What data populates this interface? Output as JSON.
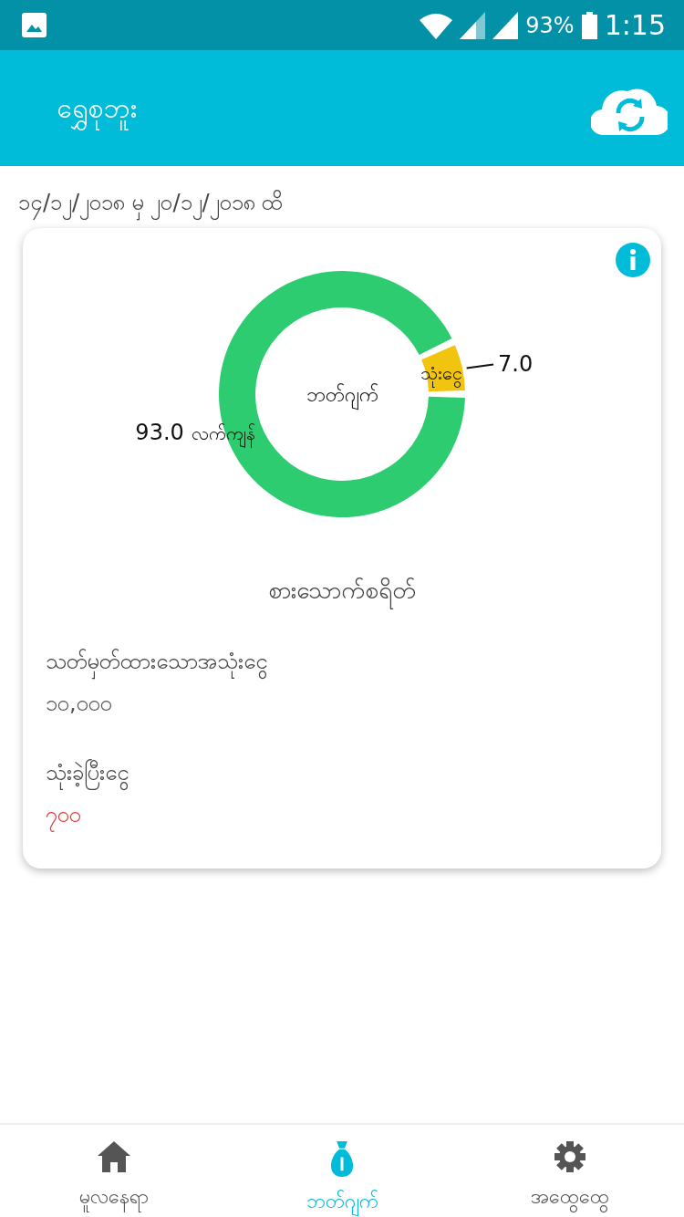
{
  "status_bar": {
    "battery": "93%",
    "time": "1:15"
  },
  "toolbar": {
    "title": "ရွှေစုဘူး"
  },
  "date_range": "၁၄/၁၂/၂၀၁၈ မှ ၂၀/၁၂/၂၀၁၈ ထိ",
  "card": {
    "chart_data": {
      "type": "donut",
      "title": "ဘတ်ဂျက်",
      "categories": [
        "သုံးငွေ",
        "လက်ကျန်"
      ],
      "values": [
        7.0,
        93.0
      ],
      "colors": [
        "#f1c40f",
        "#2ecc71"
      ],
      "data_labels": true,
      "value_labels": [
        "7.0",
        "93.0"
      ]
    },
    "category": "စားသောက်စရိတ်",
    "fields": [
      {
        "label": "သတ်မှတ်ထားသောအသုံးငွေ",
        "value": "၁၀,၀၀၀",
        "kind": "normal"
      },
      {
        "label": "သုံးခဲ့ပြီးငွေ",
        "value": "၇၀၀",
        "kind": "spent"
      }
    ]
  },
  "bottom_nav": [
    {
      "label": "မူလနေရာ",
      "kind": "home",
      "selected": false
    },
    {
      "label": "ဘတ်ဂျက်",
      "kind": "budget",
      "selected": true
    },
    {
      "label": "အထွေထွေ",
      "kind": "settings",
      "selected": false
    }
  ]
}
